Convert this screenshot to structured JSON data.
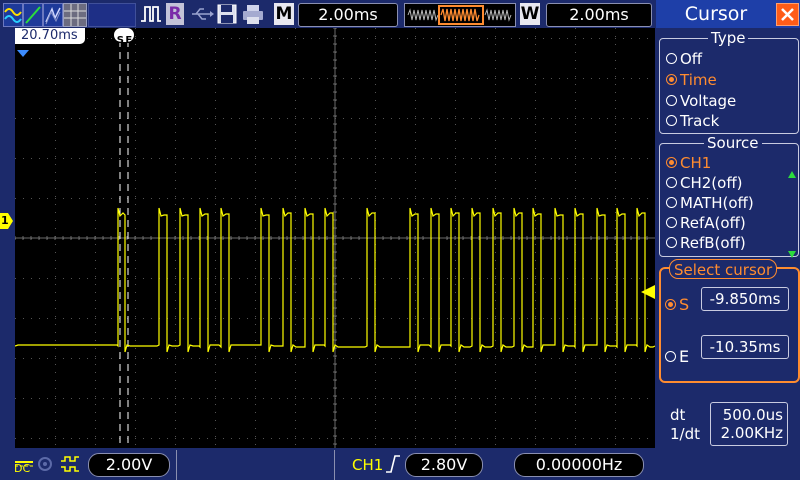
{
  "toolbar": {
    "m_label": "M",
    "m_timebase": "2.00ms",
    "w_label": "W",
    "w_timebase": "2.00ms",
    "run_label": "R"
  },
  "screen": {
    "cursor_time_readout": "20.70ms",
    "cursor_marker_label": "S E",
    "channel_marker": "1"
  },
  "bottom": {
    "coupling": "DC",
    "ch1_scale": "2.00V",
    "trigger_source": "CH1",
    "trigger_level": "2.80V",
    "frequency": "0.00000Hz"
  },
  "panel": {
    "title": "Cursor",
    "type_label": "Type",
    "type_options": [
      "Off",
      "Time",
      "Voltage",
      "Track"
    ],
    "type_selected": "Time",
    "source_label": "Source",
    "source_options": [
      "CH1",
      "CH2(off)",
      "MATH(off)",
      "RefA(off)",
      "RefB(off)"
    ],
    "source_selected": "CH1",
    "select_cursor_label": "Select cursor",
    "s_label": "S",
    "s_value": "-9.850ms",
    "e_label": "E",
    "e_value": "-10.35ms",
    "dt_label": "dt",
    "dt_value": "500.0us",
    "inv_dt_label": "1/dt",
    "inv_dt_value": "2.00KHz"
  },
  "colors": {
    "trace": "#ffff00",
    "accent": "#ff8c30",
    "panel_bg": "#1c2a6b",
    "title_bg": "#1e3fa8"
  }
}
